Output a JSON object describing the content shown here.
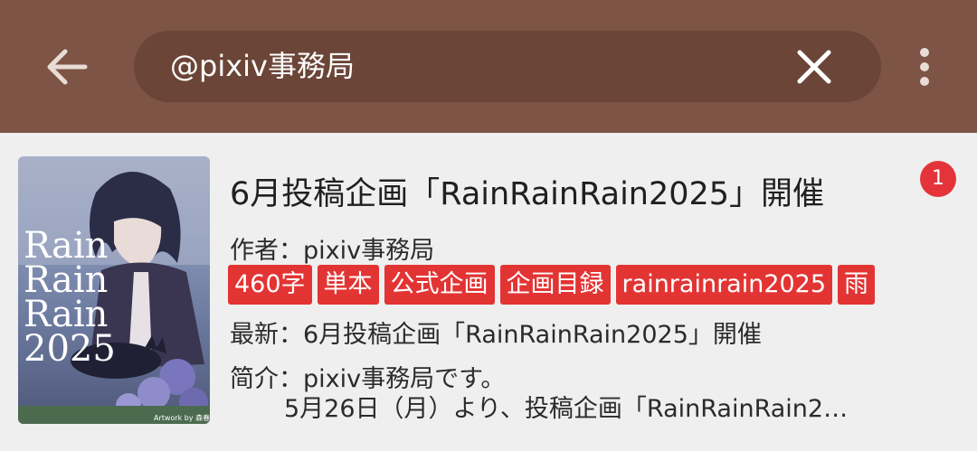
{
  "colors": {
    "toolbar": "#7d5445",
    "search_pill": "#6b4537",
    "tag": "#e33434",
    "badge": "#e4343a"
  },
  "toolbar": {
    "back_icon": "arrow-left-icon",
    "search_value": "@pixiv事務局",
    "clear_icon": "close-icon",
    "menu_icon": "more-vertical-icon"
  },
  "item": {
    "title": "6月投稿企画「RainRainRain2025」開催",
    "unread_badge": "1",
    "author_line": "作者：pixiv事務局",
    "tags": [
      "460字",
      "単本",
      "公式企画",
      "企画目録",
      "rainrainrain2025",
      "雨"
    ],
    "latest_line": "最新：6月投稿企画「RainRainRain2025」開催",
    "intro_line1": "简介：pixiv事務局です。",
    "intro_line2": "5月26日（月）より、投稿企画「RainRainRain2…",
    "cover": {
      "text_lines": [
        "Rain",
        "Rain",
        "Rain",
        "2025"
      ],
      "credit": "Artwork by 森春月"
    }
  }
}
